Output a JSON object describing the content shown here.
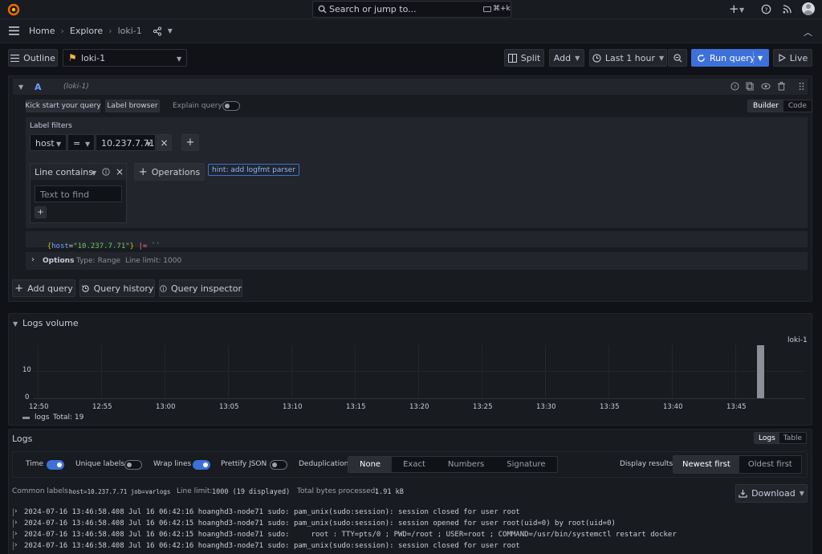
{
  "topbar": {
    "search_placeholder": "Search or jump to...",
    "shortcut": "⌘+k",
    "plus": "+"
  },
  "breadcrumb": {
    "home": "Home",
    "explore": "Explore",
    "datasource": "loki-1"
  },
  "toolbar": {
    "outline": "Outline",
    "datasource": "loki-1",
    "split": "Split",
    "add": "Add",
    "time_range": "Last 1 hour",
    "run_query": "Run query",
    "live": "Live"
  },
  "query": {
    "ref": "A",
    "ds": "(loki-1)",
    "kick_start": "Kick start your query",
    "label_browser": "Label browser",
    "explain_query": "Explain query",
    "builder": "Builder",
    "code": "Code",
    "label_filters_title": "Label filters",
    "filter_label": "host",
    "filter_op": "=",
    "filter_value": "10.237.7.71",
    "line_contains": "Line contains",
    "text_to_find": "Text to find",
    "operations": "Operations",
    "hint": "hint: add logfmt parser",
    "code_open": "{",
    "code_key": "host",
    "code_eq": "=",
    "code_val": "\"10.237.7.71\"",
    "code_close": "}",
    "code_pipe": "|=",
    "code_str": "``",
    "options": "Options",
    "options_type": "Type: Range",
    "options_limit": "Line limit: 1000"
  },
  "actions": {
    "add_query": "Add query",
    "query_history": "Query history",
    "query_inspector": "Query inspector"
  },
  "volume": {
    "title": "Logs volume",
    "series_label": "loki-1",
    "legend_name": "logs",
    "legend_total": "Total: 19"
  },
  "chart_data": {
    "type": "bar",
    "x": [
      "12:50",
      "12:55",
      "13:00",
      "13:05",
      "13:10",
      "13:15",
      "13:20",
      "13:25",
      "13:30",
      "13:35",
      "13:40",
      "13:45"
    ],
    "yticks": [
      "0",
      "10"
    ],
    "ylim": [
      0,
      19
    ],
    "series": [
      {
        "name": "logs",
        "values": [
          {
            "x": "13:47",
            "y": 19
          }
        ]
      }
    ],
    "grid": true,
    "legend": "bottom-left"
  },
  "logs": {
    "title": "Logs",
    "view_logs": "Logs",
    "view_table": "Table",
    "time": "Time",
    "unique_labels": "Unique labels",
    "wrap_lines": "Wrap lines",
    "prettify": "Prettify JSON",
    "dedup": "Deduplication",
    "dedup_options": [
      "None",
      "Exact",
      "Numbers",
      "Signature"
    ],
    "display_results": "Display results",
    "newest_first": "Newest first",
    "oldest_first": "Oldest first",
    "common_labels_title": "Common labels:",
    "common_labels_value": "host=10.237.7.71 job=varlogs",
    "line_limit_title": "Line limit:",
    "line_limit_value": "1000 (19 displayed)",
    "bytes_title": "Total bytes processed:",
    "bytes_value": "1.91 kB",
    "download": "Download",
    "lines": [
      "2024-07-16 13:46:58.408 Jul 16 06:42:16 hoanghd3-node71 sudo: pam_unix(sudo:session): session closed for user root",
      "2024-07-16 13:46:58.408 Jul 16 06:42:15 hoanghd3-node71 sudo: pam_unix(sudo:session): session opened for user root(uid=0) by root(uid=0)",
      "2024-07-16 13:46:58.408 Jul 16 06:42:15 hoanghd3-node71 sudo:     root : TTY=pts/0 ; PWD=/root ; USER=root ; COMMAND=/usr/bin/systemctl restart docker",
      "2024-07-16 13:46:58.408 Jul 16 06:42:16 hoanghd3-node71 sudo: pam_unix(sudo:session): session closed for user root"
    ]
  }
}
